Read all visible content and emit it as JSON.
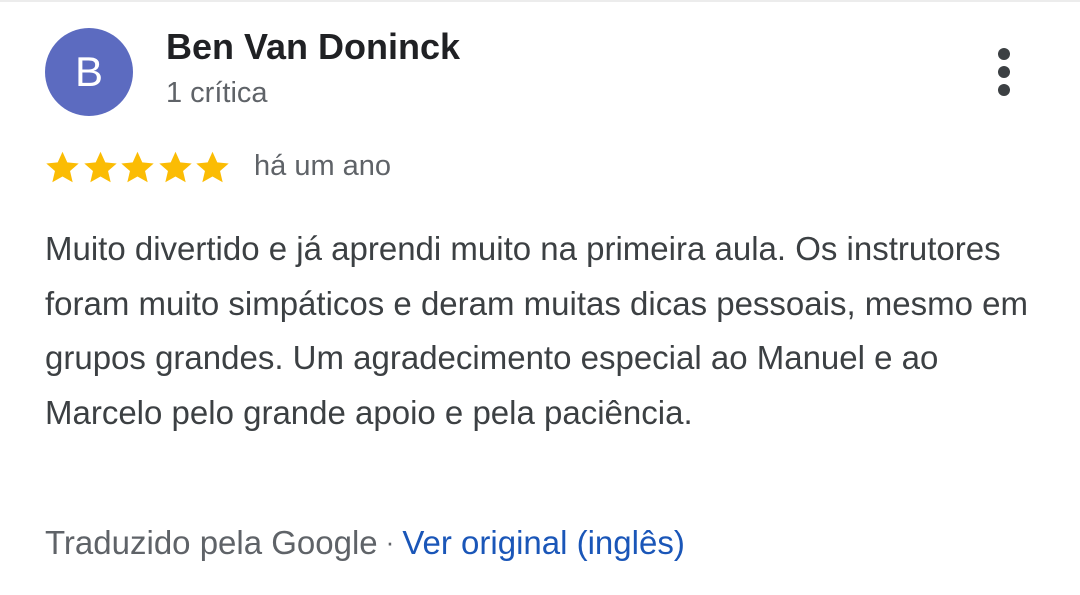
{
  "review": {
    "author": {
      "initial": "B",
      "name": "Ben Van Doninck",
      "review_count": "1 crítica",
      "avatar_color": "#5c6bc0"
    },
    "rating": {
      "value": 5,
      "max": 5,
      "star_color": "#fbbc04"
    },
    "date": "há um ano",
    "text": "Muito divertido e já aprendi muito na primeira aula. Os instrutores foram muito simpáticos e deram muitas dicas pessoais, mesmo em grupos grandes. Um agradecimento especial ao Manuel e ao Marcelo pelo grande apoio e pela paciência.",
    "translation": {
      "label": "Traduzido pela Google",
      "separator": "·",
      "link_label": "Ver original (inglês)",
      "link_color": "#1a56b8"
    },
    "menu_icon": "more-vert-icon"
  }
}
